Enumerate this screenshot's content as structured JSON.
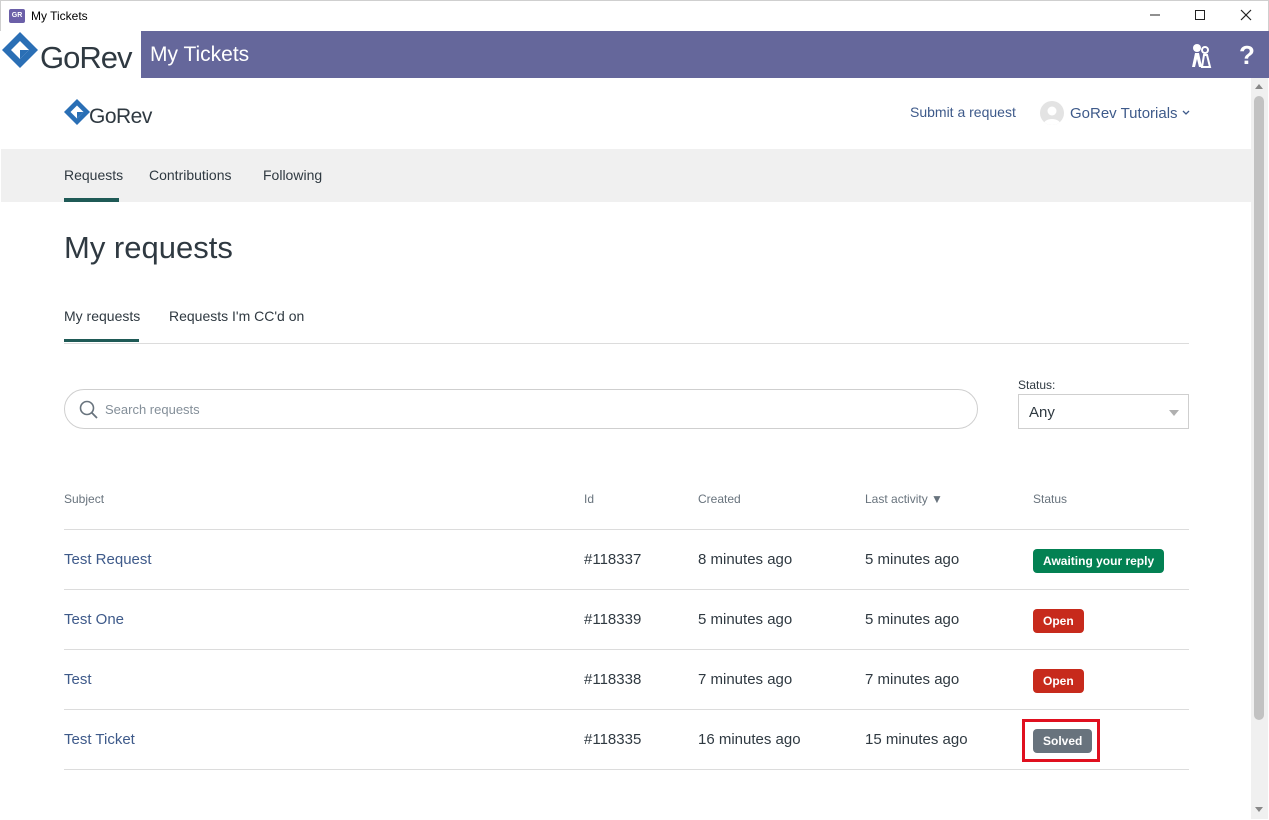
{
  "window": {
    "title": "My Tickets",
    "app_icon_text": "GR",
    "controls": [
      "minimize-icon",
      "maximize-icon",
      "close-icon"
    ]
  },
  "appbar": {
    "brand": "GoRev",
    "title": "My Tickets",
    "icons": [
      "tutorial-characters-icon",
      "help-question-icon"
    ],
    "color": "#65679b"
  },
  "site": {
    "brand": "GoRev",
    "submit_link": "Submit a request",
    "user_name": "GoRev Tutorials"
  },
  "subnav": {
    "items": [
      "Requests",
      "Contributions",
      "Following"
    ],
    "active": "Requests"
  },
  "page": {
    "title": "My requests",
    "tabs": [
      "My requests",
      "Requests I'm CC'd on"
    ],
    "active_tab": "My requests"
  },
  "filters": {
    "search_placeholder": "Search requests",
    "status_label": "Status:",
    "status_value": "Any"
  },
  "table": {
    "headers": [
      "Subject",
      "Id",
      "Created",
      "Last activity",
      "Status"
    ],
    "sort_column": "Last activity",
    "sort_indicator": "▼",
    "rows": [
      {
        "subject": "Test Request",
        "id": "#118337",
        "created": "8 minutes ago",
        "last_activity": "5 minutes ago",
        "status": "Awaiting your reply",
        "status_color": "#038153"
      },
      {
        "subject": "Test One",
        "id": "#118339",
        "created": "5 minutes ago",
        "last_activity": "5 minutes ago",
        "status": "Open",
        "status_color": "#c72a1c"
      },
      {
        "subject": "Test",
        "id": "#118338",
        "created": "7 minutes ago",
        "last_activity": "7 minutes ago",
        "status": "Open",
        "status_color": "#c72a1c"
      },
      {
        "subject": "Test Ticket",
        "id": "#118335",
        "created": "16 minutes ago",
        "last_activity": "15 minutes ago",
        "status": "Solved",
        "status_color": "#68737d"
      }
    ]
  },
  "highlight": {
    "target": "Solved",
    "color": "#e0101f"
  }
}
